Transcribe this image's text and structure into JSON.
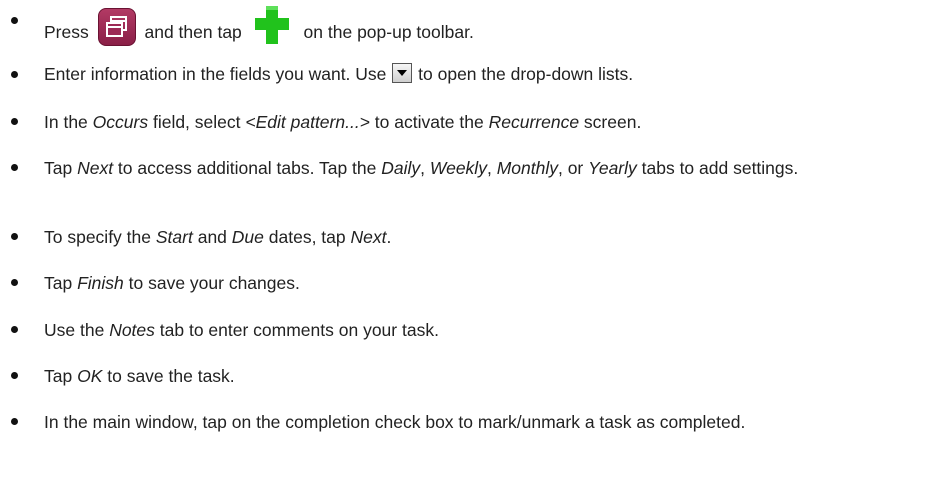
{
  "items": [
    {
      "pre": "Press",
      "icon1": "window-icon",
      "mid": "and then tap",
      "icon2": "plus-icon",
      "post": "on the pop-up toolbar."
    },
    {
      "pre": "Enter information in the fields you want. Use",
      "icon": "dropdown-arrow-icon",
      "post": "to open the drop-down lists."
    },
    {
      "t1": "In the ",
      "e1": "Occurs",
      "t2": " field, select ",
      "e2": "<Edit pattern...>",
      "t3": " to activate the ",
      "e3": "Recurrence",
      "t4": " screen."
    },
    {
      "t1": "Tap ",
      "e1": "Next",
      "t2": " to access additional tabs. Tap the ",
      "e2": "Daily",
      "t3": ", ",
      "e3": "Weekly",
      "t4": ", ",
      "e4": "Monthly",
      "t5": ", or ",
      "e5": "Yearly",
      "t6": " tabs to add settings."
    },
    {
      "t1": "To specify the ",
      "e1": "Start",
      "t2": " and ",
      "e2": "Due",
      "t3": " dates, tap ",
      "e3": "Next",
      "t4": "."
    },
    {
      "t1": "Tap ",
      "e1": "Finish",
      "t2": " to save your changes."
    },
    {
      "t1": "Use the ",
      "e1": "Notes",
      "t2": " tab to enter comments on your task."
    },
    {
      "t1": "Tap ",
      "e1": "OK",
      "t2": " to save the task."
    },
    {
      "t1": "In the main window, tap on the completion check box to mark/unmark a task as completed."
    }
  ]
}
